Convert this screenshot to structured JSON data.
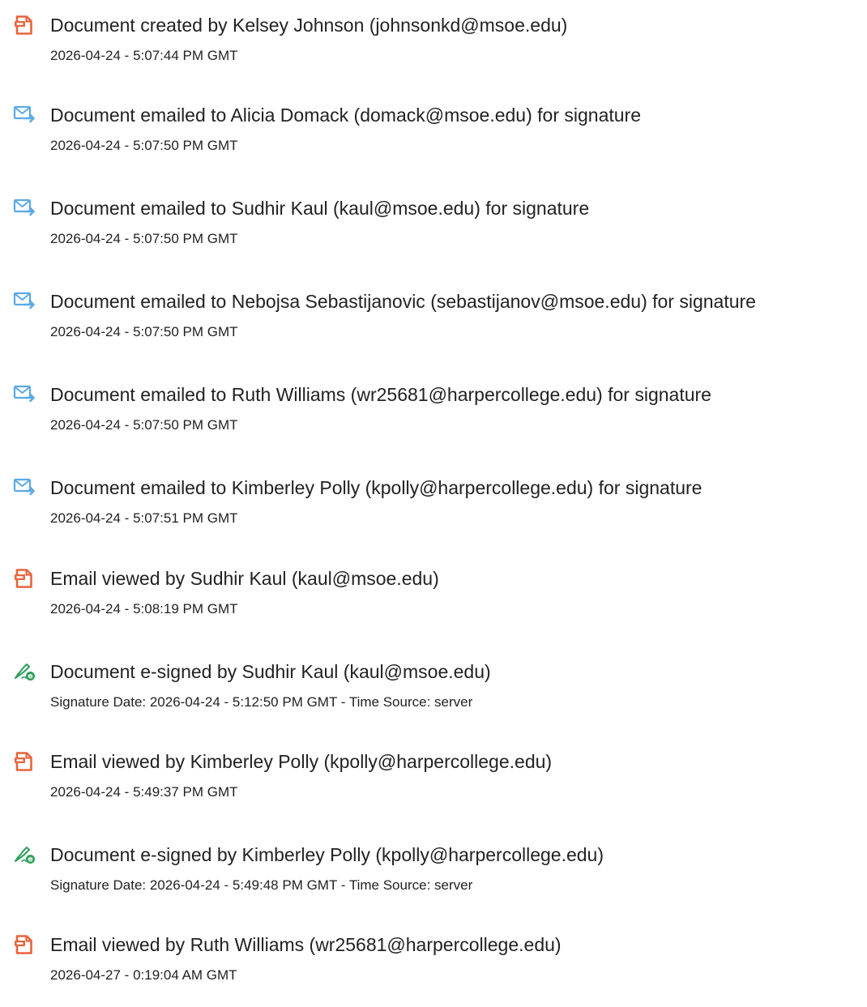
{
  "entries": [
    {
      "icon": "document-icon",
      "title": "Document created by Kelsey Johnson (johnsonkd@msoe.edu)",
      "subtitle": "2026-04-24 - 5:07:44 PM GMT"
    },
    {
      "icon": "email-sent-icon",
      "title": "Document emailed to Alicia Domack (domack@msoe.edu) for signature",
      "subtitle": "2026-04-24 - 5:07:50 PM GMT"
    },
    {
      "icon": "email-sent-icon",
      "title": "Document emailed to Sudhir Kaul (kaul@msoe.edu) for signature",
      "subtitle": "2026-04-24 - 5:07:50 PM GMT"
    },
    {
      "icon": "email-sent-icon",
      "title": "Document emailed to Nebojsa Sebastijanovic (sebastijanov@msoe.edu) for signature",
      "subtitle": "2026-04-24 - 5:07:50 PM GMT"
    },
    {
      "icon": "email-sent-icon",
      "title": "Document emailed to Ruth Williams (wr25681@harpercollege.edu) for signature",
      "subtitle": "2026-04-24 - 5:07:50 PM GMT"
    },
    {
      "icon": "email-sent-icon",
      "title": "Document emailed to Kimberley Polly (kpolly@harpercollege.edu) for signature",
      "subtitle": "2026-04-24 - 5:07:51 PM GMT"
    },
    {
      "icon": "document-icon",
      "title": "Email viewed by Sudhir Kaul (kaul@msoe.edu)",
      "subtitle": "2026-04-24 - 5:08:19 PM GMT"
    },
    {
      "icon": "esign-icon",
      "title": "Document e-signed by Sudhir Kaul (kaul@msoe.edu)",
      "subtitle": "Signature Date: 2026-04-24 - 5:12:50 PM GMT - Time Source: server"
    },
    {
      "icon": "document-icon",
      "title": "Email viewed by Kimberley Polly (kpolly@harpercollege.edu)",
      "subtitle": "2026-04-24 - 5:49:37 PM GMT"
    },
    {
      "icon": "esign-icon",
      "title": "Document e-signed by Kimberley Polly (kpolly@harpercollege.edu)",
      "subtitle": "Signature Date: 2026-04-24 - 5:49:48 PM GMT - Time Source: server"
    },
    {
      "icon": "document-icon",
      "title": "Email viewed by Ruth Williams (wr25681@harpercollege.edu)",
      "subtitle": "2026-04-27 - 0:19:04 AM GMT"
    }
  ],
  "colors": {
    "document_icon": "#E8643C",
    "email_icon": "#5AA9E6",
    "esign_icon": "#2E9E5B",
    "text": "#222222"
  }
}
